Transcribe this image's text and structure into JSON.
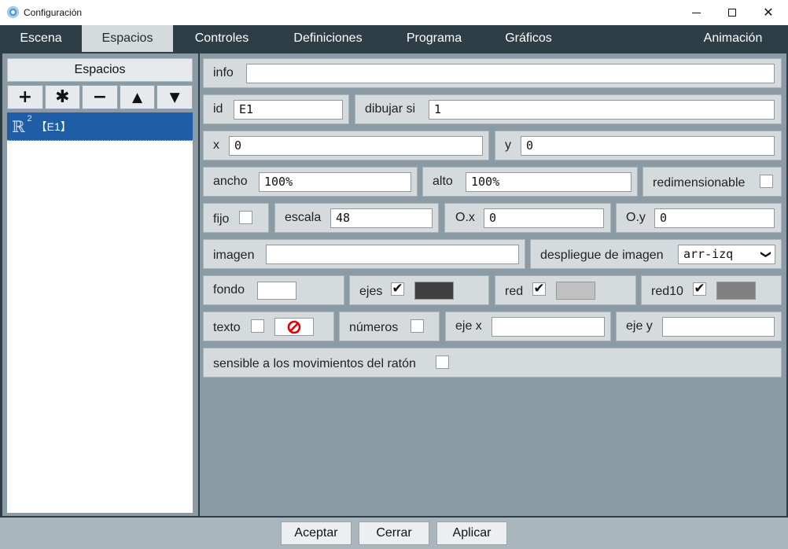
{
  "window": {
    "title": "Configuración",
    "min_glyph": "",
    "max_glyph": "",
    "close_glyph": "✕"
  },
  "tabs": [
    {
      "label": "Escena"
    },
    {
      "label": "Espacios"
    },
    {
      "label": "Controles"
    },
    {
      "label": "Definiciones"
    },
    {
      "label": "Programa"
    },
    {
      "label": "Gráficos"
    },
    {
      "label": "Animación"
    }
  ],
  "active_tab": "Espacios",
  "left": {
    "header": "Espacios",
    "toolbar": {
      "add": "+",
      "copy": "✱",
      "remove": "−",
      "up": "▲",
      "down": "▼"
    },
    "items": [
      {
        "icon": "ℝ",
        "sup": "2",
        "label": "【E1】"
      }
    ]
  },
  "form": {
    "info": {
      "label": "info",
      "value": ""
    },
    "id": {
      "label": "id",
      "value": "E1"
    },
    "dibujar_si": {
      "label": "dibujar si",
      "value": "1"
    },
    "x": {
      "label": "x",
      "value": "0"
    },
    "y": {
      "label": "y",
      "value": "0"
    },
    "ancho": {
      "label": "ancho",
      "value": "100%"
    },
    "alto": {
      "label": "alto",
      "value": "100%"
    },
    "redimensionable": {
      "label": "redimensionable",
      "checked": false,
      "mark": ""
    },
    "fijo": {
      "label": "fijo",
      "checked": false,
      "mark": ""
    },
    "escala": {
      "label": "escala",
      "value": "48"
    },
    "ox": {
      "label": "O.x",
      "value": "0"
    },
    "oy": {
      "label": "O.y",
      "value": "0"
    },
    "imagen": {
      "label": "imagen",
      "value": ""
    },
    "despliegue": {
      "label": "despliegue de imagen",
      "value": "arr-izq",
      "chevron": "❯"
    },
    "fondo": {
      "label": "fondo",
      "color": "#ffffff"
    },
    "ejes": {
      "label": "ejes",
      "checked": true,
      "mark": "✔",
      "color": "#404040"
    },
    "red": {
      "label": "red",
      "checked": true,
      "mark": "✔",
      "color": "#c0c0c0"
    },
    "red10": {
      "label": "red10",
      "checked": true,
      "mark": "✔",
      "color": "#808080"
    },
    "texto": {
      "label": "texto",
      "checked": false,
      "mark": ""
    },
    "numeros": {
      "label": "números",
      "checked": false,
      "mark": ""
    },
    "eje_x": {
      "label": "eje x",
      "value": ""
    },
    "eje_y": {
      "label": "eje y",
      "value": ""
    },
    "sensible": {
      "label": "sensible a los movimientos del ratón",
      "checked": false,
      "mark": ""
    }
  },
  "buttons": {
    "aceptar": "Aceptar",
    "cerrar": "Cerrar",
    "aplicar": "Aplicar"
  },
  "colors": {
    "tabbar": "#2e3e46",
    "panel": "#8a9ba6",
    "selected": "#1f5da6",
    "no_color": "#e00000"
  }
}
